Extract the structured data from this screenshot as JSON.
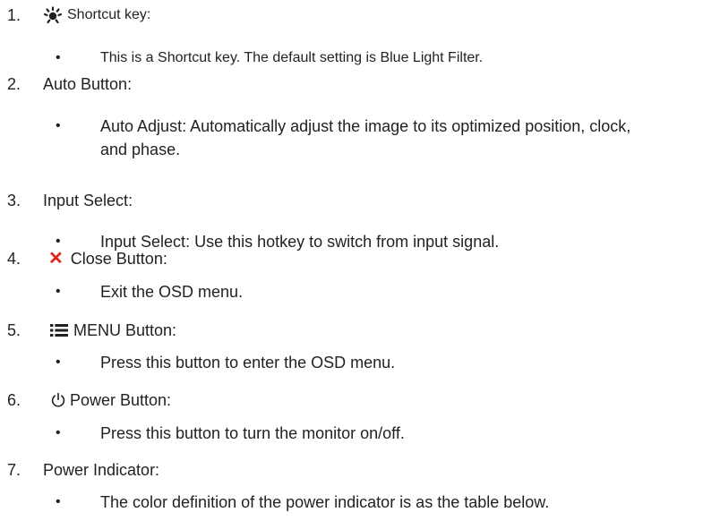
{
  "items": [
    {
      "number": "1.",
      "icon": "brightness-sun-icon",
      "title": "Shortcut key:",
      "bullets": [
        "This is a Shortcut key. The default setting is Blue Light Filter."
      ]
    },
    {
      "number": "2.",
      "title": "Auto Button:",
      "bullets": [
        "Auto Adjust: Automatically adjust the image to its optimized position, clock, and phase."
      ]
    },
    {
      "number": "3.",
      "title": "Input Select:",
      "bullets": [
        "Input Select: Use this hotkey to switch from input signal."
      ]
    },
    {
      "number": "4.",
      "icon": "close-x-icon",
      "icon_color": "#e2231a",
      "title": "Close Button:",
      "bullets": [
        "Exit the OSD menu."
      ]
    },
    {
      "number": "5.",
      "icon": "menu-list-icon",
      "title": "MENU Button:",
      "bullets": [
        "Press this button to enter the OSD menu."
      ]
    },
    {
      "number": "6.",
      "icon": "power-icon",
      "title": "Power Button:",
      "bullets": [
        "Press this button to turn the monitor on/off."
      ]
    },
    {
      "number": "7.",
      "title": "Power Indicator:",
      "bullets": [
        "The color definition of the power indicator is as the table below."
      ]
    }
  ],
  "bullet_glyph": "•"
}
